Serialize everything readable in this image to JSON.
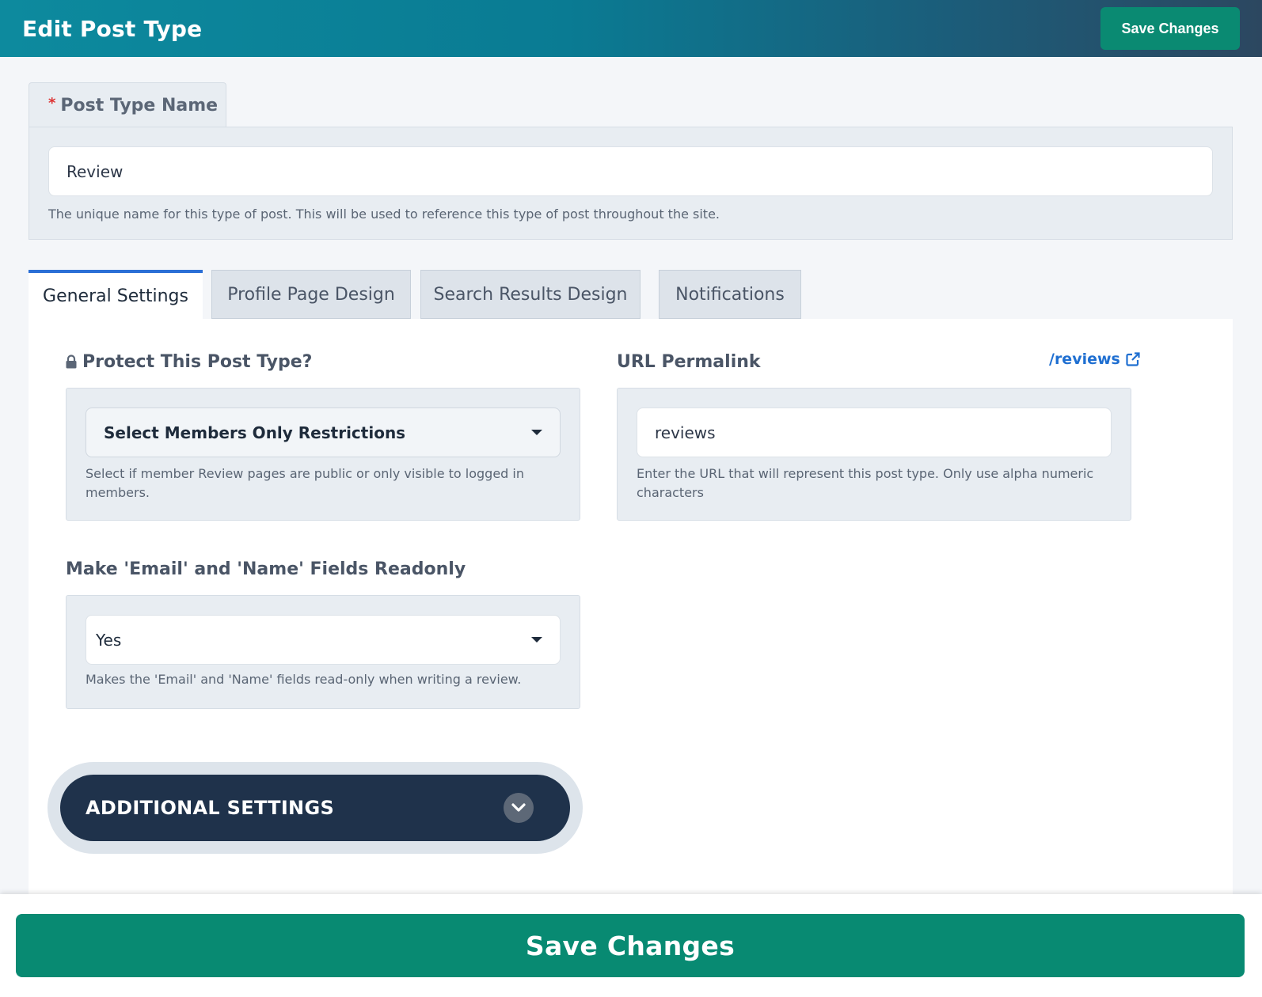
{
  "header": {
    "title": "Edit Post Type",
    "save_label": "Save Changes"
  },
  "post_type_name": {
    "required_marker": "*",
    "label": "Post Type Name",
    "value": "Review",
    "help": "The unique name for this type of post. This will be used to reference this type of post throughout the site."
  },
  "tabs": [
    {
      "label": "General Settings",
      "active": true
    },
    {
      "label": "Profile Page Design",
      "active": false
    },
    {
      "label": "Search Results Design",
      "active": false
    },
    {
      "label": "Notifications",
      "active": false
    }
  ],
  "protect": {
    "label": "Protect This Post Type?",
    "icon": "lock-icon",
    "selected": "Select Members Only Restrictions",
    "help": "Select if member Review pages are public or only visible to logged in members."
  },
  "permalink": {
    "label": "URL Permalink",
    "link_text": "/reviews",
    "link_icon": "external-link-icon",
    "value": "reviews",
    "help": "Enter the URL that will represent this post type. Only use alpha numeric characters"
  },
  "readonly": {
    "label": "Make 'Email' and 'Name' Fields Readonly",
    "selected": "Yes",
    "help": "Makes the 'Email' and 'Name' fields read-only when writing a review."
  },
  "additional_settings": {
    "label": "ADDITIONAL SETTINGS",
    "icon": "chevron-down-icon"
  },
  "footer": {
    "save_label": "Save Changes"
  },
  "colors": {
    "accent_green": "#088a72",
    "link_blue": "#1f6fd1",
    "active_tab_border": "#2b6fd6",
    "dark_navy": "#1f324b"
  }
}
